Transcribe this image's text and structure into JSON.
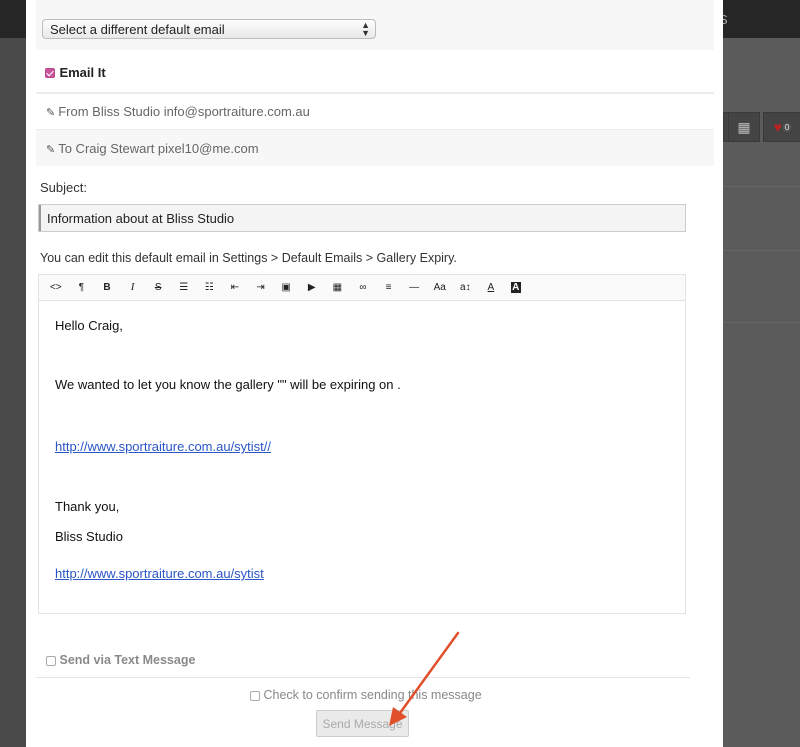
{
  "background": {
    "header_right_text": "S",
    "heart_count": "0"
  },
  "email_select": {
    "value": "Select a different default email"
  },
  "email_it": {
    "label": "Email It",
    "checked": true
  },
  "from": {
    "text": "From Bliss Studio info@sportraiture.com.au"
  },
  "to": {
    "text": "To Craig Stewart pixel10@me.com"
  },
  "subject": {
    "label": "Subject:",
    "value": "Information about  at Bliss Studio"
  },
  "edit_note": "You can edit this default email in Settings > Default Emails > Gallery Expiry.",
  "toolbar": [
    {
      "icon": "code-icon",
      "glyph": "<>"
    },
    {
      "icon": "paragraph-icon",
      "glyph": "¶"
    },
    {
      "icon": "bold-icon",
      "glyph": "B"
    },
    {
      "icon": "italic-icon",
      "glyph": "I"
    },
    {
      "icon": "strikethrough-icon",
      "glyph": "S"
    },
    {
      "icon": "unordered-list-icon",
      "glyph": "☰"
    },
    {
      "icon": "ordered-list-icon",
      "glyph": "☷"
    },
    {
      "icon": "outdent-icon",
      "glyph": "⇤"
    },
    {
      "icon": "indent-icon",
      "glyph": "⇥"
    },
    {
      "icon": "image-icon",
      "glyph": "▣"
    },
    {
      "icon": "video-icon",
      "glyph": "▶"
    },
    {
      "icon": "table-icon",
      "glyph": "▦"
    },
    {
      "icon": "link-icon",
      "glyph": "∞"
    },
    {
      "icon": "align-icon",
      "glyph": "≡"
    },
    {
      "icon": "horizontal-rule-icon",
      "glyph": "—"
    },
    {
      "icon": "font-size-icon",
      "glyph": "Aa"
    },
    {
      "icon": "text-transform-icon",
      "glyph": "a↕"
    },
    {
      "icon": "font-color-icon",
      "glyph": "A"
    },
    {
      "icon": "background-color-icon",
      "glyph": "A"
    }
  ],
  "body": {
    "greeting": "Hello Craig,",
    "line1": "We wanted to let you know the gallery \"\" will be expiring on .",
    "link1": "http://www.sportraiture.com.au/sytist//",
    "thanks": "Thank you,",
    "signature": "Bliss Studio",
    "link2": "http://www.sportraiture.com.au/sytist"
  },
  "text_message": {
    "label": "Send via Text Message",
    "checked": false
  },
  "confirm": {
    "label": "Check to confirm sending this message",
    "checked": false
  },
  "send_button": "Send Message",
  "colors": {
    "accent_checkbox": "#c9569b",
    "link": "#2a56c6",
    "annotation_arrow": "#e0502a"
  }
}
